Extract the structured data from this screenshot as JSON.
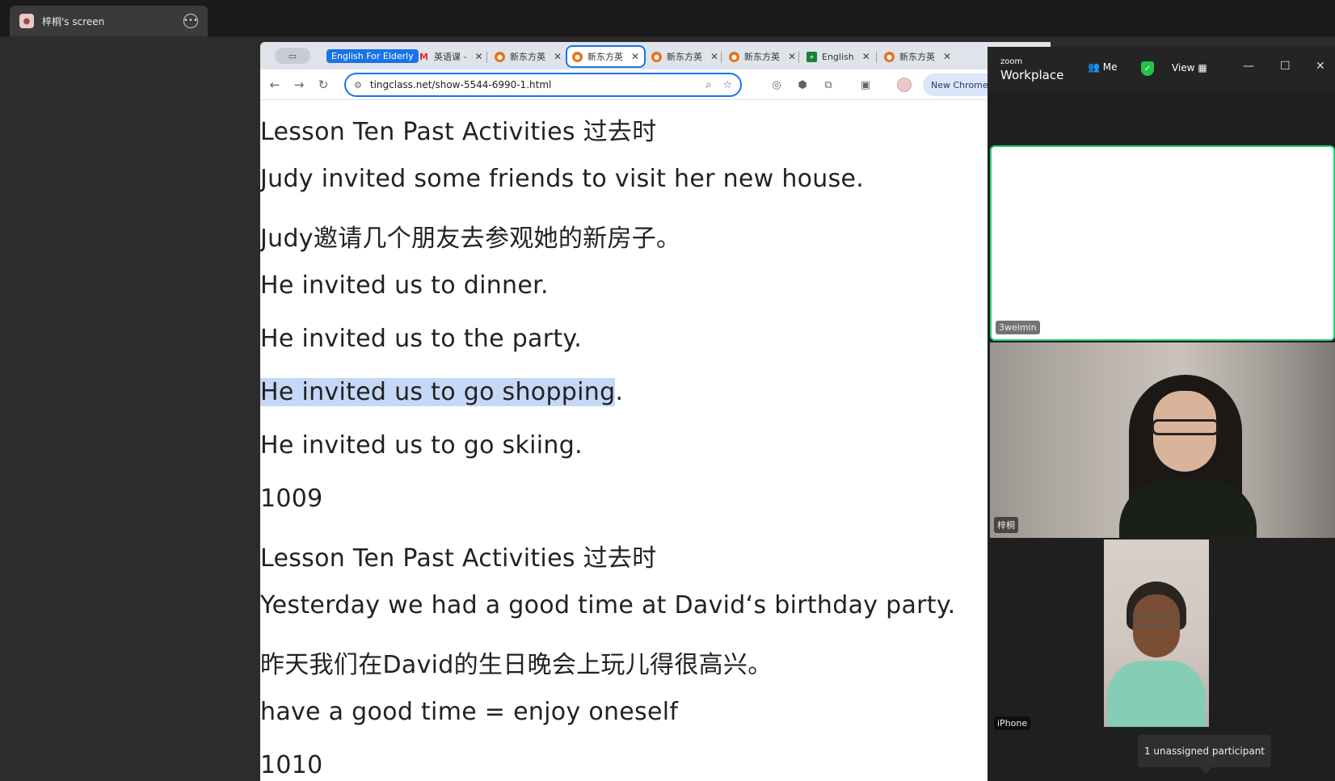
{
  "share": {
    "title": "梓桐's screen",
    "more_icon": "ellipsis-icon"
  },
  "browser": {
    "tab_group": "English For Elderly",
    "tabs": [
      {
        "label": "英语课 -",
        "icon": "gmail-icon"
      },
      {
        "label": "新东方英",
        "icon": "orange-site-icon"
      },
      {
        "label": "新东方英",
        "icon": "orange-site-icon",
        "active": true
      },
      {
        "label": "新东方英",
        "icon": "orange-site-icon"
      },
      {
        "label": "新东方英",
        "icon": "orange-site-icon"
      },
      {
        "label": "English",
        "icon": "sheets-icon"
      },
      {
        "label": "新东方英",
        "icon": "orange-site-icon"
      }
    ],
    "url": "tingclass.net/show-5544-6990-1.html",
    "new_chrome_label": "New Chrome"
  },
  "content": {
    "lines": [
      "Lesson Ten Past Activities 过去时",
      "Judy invited some friends to visit her new house.",
      "Judy邀请几个朋友去参观她的新房子。",
      "He invited us to dinner.",
      "He invited us to the party.",
      "He invited us to go shopping.",
      "He invited us to go skiing.",
      "1009",
      "Lesson Ten Past Activities 过去时",
      "Yesterday we had a good time at David‘s birthday party.",
      "昨天我们在David的生日晚会上玩儿得很高兴。",
      "have a good time = enjoy oneself",
      "1010"
    ],
    "highlight_part": "He invited us to go shopping",
    "highlight_rest": "."
  },
  "zoom": {
    "logo_top": "zoom",
    "logo_bottom": "Workplace",
    "meet_label": "Me",
    "view_label": "View",
    "participants": [
      {
        "name": "3weimin"
      },
      {
        "name": "梓桐"
      },
      {
        "name": "iPhone"
      }
    ],
    "tooltip": "1 unassigned participant"
  }
}
